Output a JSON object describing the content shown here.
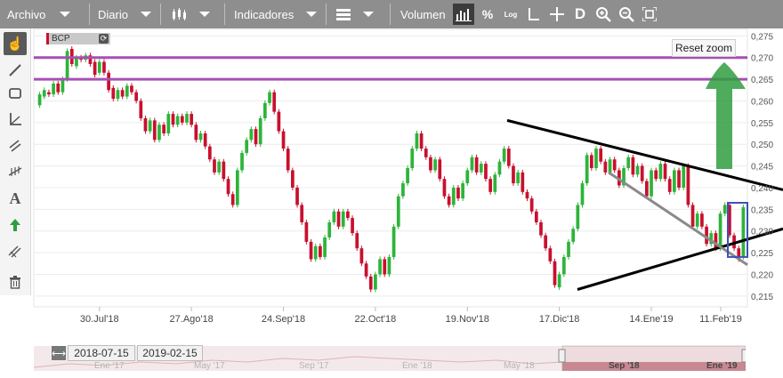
{
  "toolbar": {
    "menu_file": "Archivo",
    "period": "Diario",
    "indicators": "Indicadores",
    "volume": "Volumen",
    "percent": "%",
    "log": "Log",
    "dark": "D"
  },
  "symbol": "BCP",
  "reset_zoom": "Reset zoom",
  "navigator": {
    "start_date": "2018-07-15",
    "end_date": "2019-02-15",
    "ticks": [
      "Ene '17",
      "May '17",
      "Sep '17",
      "Ene '18",
      "May '18",
      "Sep '18",
      "Ene '19"
    ]
  },
  "colors": {
    "up": "#2db43a",
    "down": "#c8102e",
    "resistance": "#a64fb4",
    "trendline": "#000000",
    "channel": "#8a8a8a",
    "highlight_box": "#3f51b5",
    "arrow": "#2f9e3f"
  },
  "icons": [
    "pointer-icon",
    "line-icon",
    "rectangle-icon",
    "angle-icon",
    "parallel-lines-icon",
    "fibonacci-icon",
    "text-icon",
    "arrow-up-icon",
    "pattern-icon",
    "trash-icon",
    "candles-icon",
    "chevron-down-icon",
    "bars-icon",
    "crosshair-icon",
    "zoom-in-icon",
    "zoom-out-icon",
    "fit-icon"
  ],
  "chart_data": {
    "type": "candlestick",
    "x_labels": [
      "30.Jul'18",
      "27.Ago'18",
      "24.Sep'18",
      "22.Oct'18",
      "19.Nov'18",
      "17.Dic'18",
      "14.Ene'19",
      "11.Feb'19"
    ],
    "y_ticks": [
      "0,275",
      "0,270",
      "0,265",
      "0,260",
      "0,255",
      "0,250",
      "0,245",
      "0,240",
      "0,235",
      "0,230",
      "0,225",
      "0,220",
      "0,215"
    ],
    "ylim": [
      0.2125,
      0.2765
    ],
    "resistance_levels": [
      0.27,
      0.265
    ],
    "trendlines": [
      {
        "from": [
          "2018-11-30",
          0.2555
        ],
        "to": [
          "2019-02-28",
          0.2395
        ],
        "color": "trendline"
      },
      {
        "from": [
          "2018-12-27",
          0.2165
        ],
        "to": [
          "2019-02-28",
          0.2305
        ],
        "color": "trendline"
      },
      {
        "from": [
          "2019-01-07",
          0.2435
        ],
        "to": [
          "2019-02-20",
          0.222
        ],
        "color": "channel"
      }
    ],
    "candles": [
      {
        "o": 0.259,
        "c": 0.2615
      },
      {
        "o": 0.261,
        "c": 0.2625
      },
      {
        "o": 0.262,
        "c": 0.2615
      },
      {
        "o": 0.2615,
        "c": 0.264
      },
      {
        "o": 0.264,
        "c": 0.262
      },
      {
        "o": 0.262,
        "c": 0.265
      },
      {
        "o": 0.265,
        "c": 0.2715
      },
      {
        "o": 0.272,
        "c": 0.2685
      },
      {
        "o": 0.268,
        "c": 0.27
      },
      {
        "o": 0.27,
        "c": 0.2695
      },
      {
        "o": 0.2695,
        "c": 0.2705
      },
      {
        "o": 0.2705,
        "c": 0.2685
      },
      {
        "o": 0.269,
        "c": 0.266
      },
      {
        "o": 0.2665,
        "c": 0.269
      },
      {
        "o": 0.269,
        "c": 0.2665
      },
      {
        "o": 0.2665,
        "c": 0.2625
      },
      {
        "o": 0.263,
        "c": 0.2605
      },
      {
        "o": 0.2605,
        "c": 0.2625
      },
      {
        "o": 0.2625,
        "c": 0.261
      },
      {
        "o": 0.261,
        "c": 0.2635
      },
      {
        "o": 0.2635,
        "c": 0.262
      },
      {
        "o": 0.262,
        "c": 0.26
      },
      {
        "o": 0.26,
        "c": 0.256
      },
      {
        "o": 0.256,
        "c": 0.253
      },
      {
        "o": 0.253,
        "c": 0.2555
      },
      {
        "o": 0.2555,
        "c": 0.251
      },
      {
        "o": 0.251,
        "c": 0.2545
      },
      {
        "o": 0.2545,
        "c": 0.2525
      },
      {
        "o": 0.2525,
        "c": 0.257
      },
      {
        "o": 0.257,
        "c": 0.2545
      },
      {
        "o": 0.2545,
        "c": 0.2565
      },
      {
        "o": 0.2565,
        "c": 0.255
      },
      {
        "o": 0.255,
        "c": 0.257
      },
      {
        "o": 0.257,
        "c": 0.2545
      },
      {
        "o": 0.2545,
        "c": 0.251
      },
      {
        "o": 0.251,
        "c": 0.2525
      },
      {
        "o": 0.2525,
        "c": 0.2495
      },
      {
        "o": 0.2495,
        "c": 0.2465
      },
      {
        "o": 0.2465,
        "c": 0.2435
      },
      {
        "o": 0.2435,
        "c": 0.246
      },
      {
        "o": 0.246,
        "c": 0.242
      },
      {
        "o": 0.242,
        "c": 0.2385
      },
      {
        "o": 0.2385,
        "c": 0.236
      },
      {
        "o": 0.236,
        "c": 0.244
      },
      {
        "o": 0.244,
        "c": 0.248
      },
      {
        "o": 0.248,
        "c": 0.251
      },
      {
        "o": 0.251,
        "c": 0.2535
      },
      {
        "o": 0.2535,
        "c": 0.25
      },
      {
        "o": 0.25,
        "c": 0.256
      },
      {
        "o": 0.256,
        "c": 0.2595
      },
      {
        "o": 0.2595,
        "c": 0.262
      },
      {
        "o": 0.262,
        "c": 0.2575
      },
      {
        "o": 0.2575,
        "c": 0.253
      },
      {
        "o": 0.253,
        "c": 0.249
      },
      {
        "o": 0.249,
        "c": 0.244
      },
      {
        "o": 0.244,
        "c": 0.24
      },
      {
        "o": 0.24,
        "c": 0.236
      },
      {
        "o": 0.236,
        "c": 0.232
      },
      {
        "o": 0.232,
        "c": 0.2275
      },
      {
        "o": 0.2275,
        "c": 0.2235
      },
      {
        "o": 0.2235,
        "c": 0.2265
      },
      {
        "o": 0.2265,
        "c": 0.224
      },
      {
        "o": 0.224,
        "c": 0.2285
      },
      {
        "o": 0.2285,
        "c": 0.232
      },
      {
        "o": 0.232,
        "c": 0.2345
      },
      {
        "o": 0.2345,
        "c": 0.231
      },
      {
        "o": 0.231,
        "c": 0.2345
      },
      {
        "o": 0.2345,
        "c": 0.233
      },
      {
        "o": 0.233,
        "c": 0.2295
      },
      {
        "o": 0.2295,
        "c": 0.226
      },
      {
        "o": 0.226,
        "c": 0.2225
      },
      {
        "o": 0.2225,
        "c": 0.2195
      },
      {
        "o": 0.2195,
        "c": 0.2165
      },
      {
        "o": 0.2165,
        "c": 0.22
      },
      {
        "o": 0.22,
        "c": 0.2235
      },
      {
        "o": 0.2235,
        "c": 0.22
      },
      {
        "o": 0.22,
        "c": 0.224
      },
      {
        "o": 0.224,
        "c": 0.231
      },
      {
        "o": 0.231,
        "c": 0.238
      },
      {
        "o": 0.238,
        "c": 0.241
      },
      {
        "o": 0.241,
        "c": 0.2445
      },
      {
        "o": 0.2445,
        "c": 0.249
      },
      {
        "o": 0.249,
        "c": 0.2525
      },
      {
        "o": 0.2525,
        "c": 0.249
      },
      {
        "o": 0.249,
        "c": 0.247
      },
      {
        "o": 0.247,
        "c": 0.244
      },
      {
        "o": 0.244,
        "c": 0.2465
      },
      {
        "o": 0.2465,
        "c": 0.242
      },
      {
        "o": 0.242,
        "c": 0.238
      },
      {
        "o": 0.238,
        "c": 0.236
      },
      {
        "o": 0.236,
        "c": 0.24
      },
      {
        "o": 0.24,
        "c": 0.2375
      },
      {
        "o": 0.2375,
        "c": 0.241
      },
      {
        "o": 0.241,
        "c": 0.244
      },
      {
        "o": 0.244,
        "c": 0.247
      },
      {
        "o": 0.247,
        "c": 0.2435
      },
      {
        "o": 0.2435,
        "c": 0.2455
      },
      {
        "o": 0.2455,
        "c": 0.242
      },
      {
        "o": 0.242,
        "c": 0.239
      },
      {
        "o": 0.239,
        "c": 0.243
      },
      {
        "o": 0.243,
        "c": 0.246
      },
      {
        "o": 0.246,
        "c": 0.249
      },
      {
        "o": 0.249,
        "c": 0.245
      },
      {
        "o": 0.245,
        "c": 0.241
      },
      {
        "o": 0.241,
        "c": 0.2435
      },
      {
        "o": 0.2435,
        "c": 0.239
      },
      {
        "o": 0.239,
        "c": 0.2375
      },
      {
        "o": 0.2375,
        "c": 0.2345
      },
      {
        "o": 0.2345,
        "c": 0.232
      },
      {
        "o": 0.232,
        "c": 0.229
      },
      {
        "o": 0.229,
        "c": 0.226
      },
      {
        "o": 0.226,
        "c": 0.223
      },
      {
        "o": 0.223,
        "c": 0.2175
      },
      {
        "o": 0.217,
        "c": 0.22
      },
      {
        "o": 0.22,
        "c": 0.224
      },
      {
        "o": 0.224,
        "c": 0.2275
      },
      {
        "o": 0.2275,
        "c": 0.2305
      },
      {
        "o": 0.2305,
        "c": 0.236
      },
      {
        "o": 0.236,
        "c": 0.241
      },
      {
        "o": 0.241,
        "c": 0.2475
      },
      {
        "o": 0.2475,
        "c": 0.2445
      },
      {
        "o": 0.2445,
        "c": 0.249
      },
      {
        "o": 0.249,
        "c": 0.246
      },
      {
        "o": 0.246,
        "c": 0.2435
      },
      {
        "o": 0.2435,
        "c": 0.2465
      },
      {
        "o": 0.2465,
        "c": 0.244
      },
      {
        "o": 0.244,
        "c": 0.2405
      },
      {
        "o": 0.2405,
        "c": 0.2445
      },
      {
        "o": 0.2445,
        "c": 0.247
      },
      {
        "o": 0.247,
        "c": 0.243
      },
      {
        "o": 0.243,
        "c": 0.245
      },
      {
        "o": 0.245,
        "c": 0.2415
      },
      {
        "o": 0.2415,
        "c": 0.238
      },
      {
        "o": 0.238,
        "c": 0.244
      },
      {
        "o": 0.244,
        "c": 0.242
      },
      {
        "o": 0.242,
        "c": 0.2455
      },
      {
        "o": 0.2455,
        "c": 0.242
      },
      {
        "o": 0.242,
        "c": 0.239
      },
      {
        "o": 0.239,
        "c": 0.244
      },
      {
        "o": 0.244,
        "c": 0.24
      },
      {
        "o": 0.24,
        "c": 0.245
      },
      {
        "o": 0.245,
        "c": 0.236
      },
      {
        "o": 0.236,
        "c": 0.231
      },
      {
        "o": 0.231,
        "c": 0.234
      },
      {
        "o": 0.234,
        "c": 0.231
      },
      {
        "o": 0.231,
        "c": 0.227
      },
      {
        "o": 0.227,
        "c": 0.2295
      },
      {
        "o": 0.2295,
        "c": 0.226
      },
      {
        "o": 0.226,
        "c": 0.234
      },
      {
        "o": 0.234,
        "c": 0.236
      },
      {
        "o": 0.236,
        "c": 0.229
      },
      {
        "o": 0.229,
        "c": 0.226
      },
      {
        "o": 0.226,
        "c": 0.2235
      },
      {
        "o": 0.224,
        "c": 0.2355
      }
    ]
  }
}
